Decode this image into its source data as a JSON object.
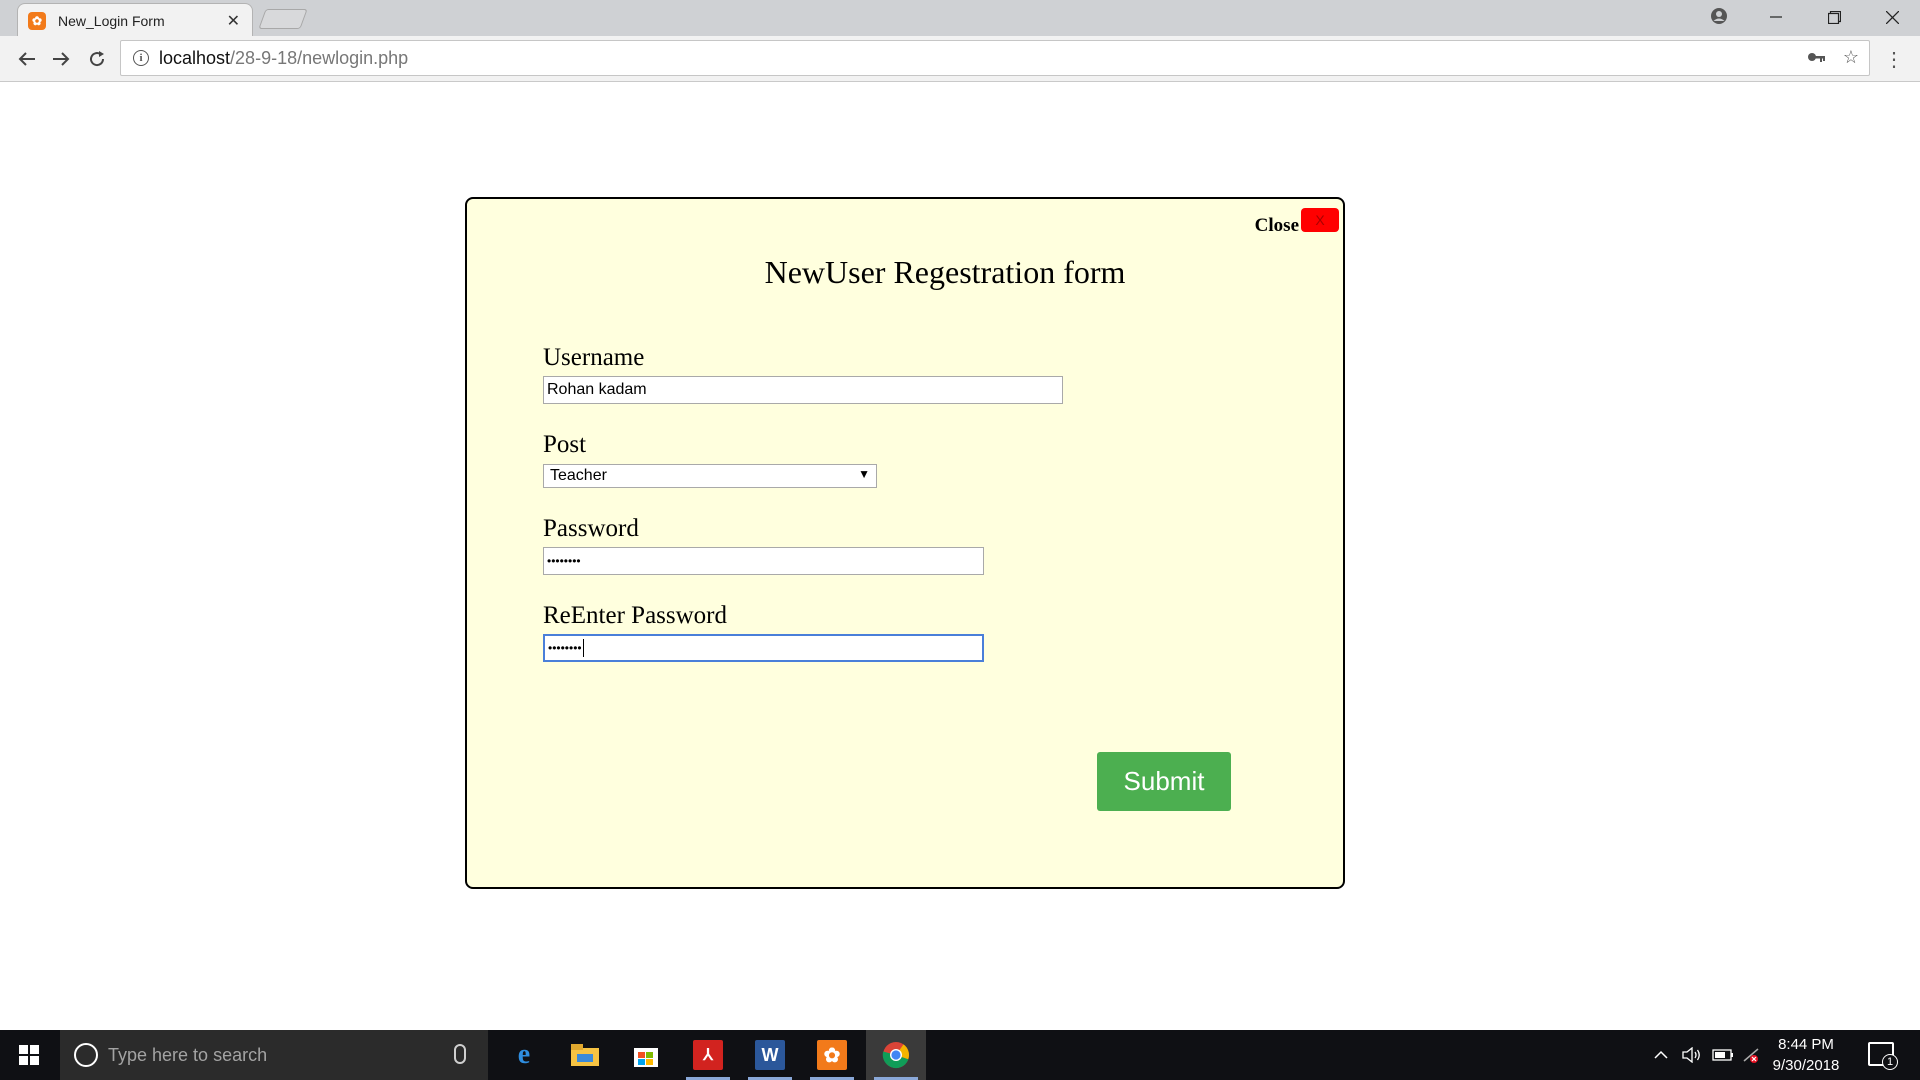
{
  "browser": {
    "tab_title": "New_Login Form",
    "tab_close": "✕",
    "url_host": "localhost",
    "url_path": "/28-9-18/newlogin.php"
  },
  "dialog": {
    "close_label": "Close",
    "close_x": "X",
    "title": "NewUser Regestration form",
    "username_label": "Username",
    "username_value": "Rohan kadam",
    "post_label": "Post",
    "post_selected": "Teacher",
    "password_label": "Password",
    "password_value": "••••••••",
    "reenter_label": "ReEnter Password",
    "reenter_value": "••••••••",
    "submit_label": "Submit"
  },
  "taskbar": {
    "search_placeholder": "Type here to search",
    "apps": [
      "edge-icon",
      "file-explorer-icon",
      "store-icon",
      "acrobat-icon",
      "word-icon",
      "xampp-icon",
      "chrome-icon"
    ],
    "time": "8:44 PM",
    "date": "9/30/2018",
    "notification_count": "1"
  },
  "colors": {
    "dialog_bg": "#ffffde",
    "submit_bg": "#4caf50",
    "close_bg": "#ff0000",
    "taskbar_bg": "#0f1014"
  }
}
